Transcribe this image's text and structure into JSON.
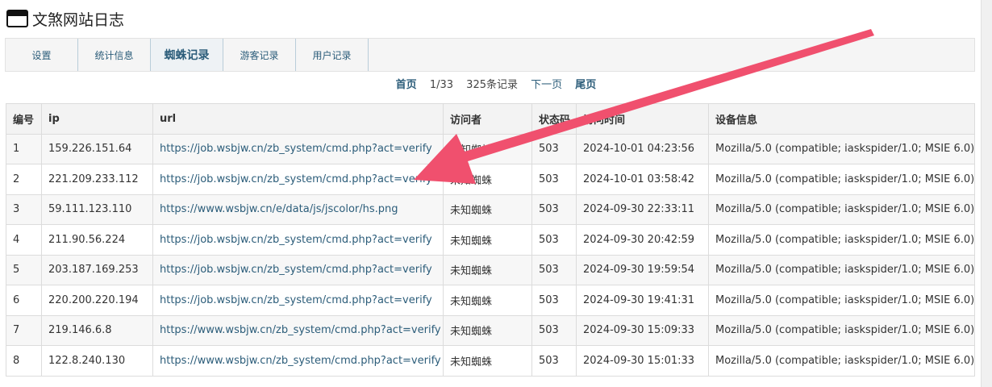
{
  "title": "文煞网站日志",
  "nav": {
    "tabs": [
      {
        "label": "设置",
        "active": false
      },
      {
        "label": "统计信息",
        "active": false
      },
      {
        "label": "蜘蛛记录",
        "active": true
      },
      {
        "label": "游客记录",
        "active": false
      },
      {
        "label": "用户记录",
        "active": false
      }
    ]
  },
  "pager": {
    "first": "首页",
    "page": "1/33",
    "count": "325条记录",
    "next": "下一页",
    "last": "尾页"
  },
  "table": {
    "headers": [
      "编号",
      "ip",
      "url",
      "访问者",
      "状态码",
      "访问时间",
      "设备信息"
    ],
    "rows": [
      [
        "1",
        "159.226.151.64",
        "https://job.wsbjw.cn/zb_system/cmd.php?act=verify",
        "未知蜘蛛",
        "503",
        "2024-10-01 04:23:56",
        "Mozilla/5.0 (compatible; iaskspider/1.0; MSIE 6.0)"
      ],
      [
        "2",
        "221.209.233.112",
        "https://job.wsbjw.cn/zb_system/cmd.php?act=verify",
        "未知蜘蛛",
        "503",
        "2024-10-01 03:58:42",
        "Mozilla/5.0 (compatible; iaskspider/1.0; MSIE 6.0)"
      ],
      [
        "3",
        "59.111.123.110",
        "https://www.wsbjw.cn/e/data/js/jscolor/hs.png",
        "未知蜘蛛",
        "503",
        "2024-09-30 22:33:11",
        "Mozilla/5.0 (compatible; iaskspider/1.0; MSIE 6.0)"
      ],
      [
        "4",
        "211.90.56.224",
        "https://job.wsbjw.cn/zb_system/cmd.php?act=verify",
        "未知蜘蛛",
        "503",
        "2024-09-30 20:42:59",
        "Mozilla/5.0 (compatible; iaskspider/1.0; MSIE 6.0)"
      ],
      [
        "5",
        "203.187.169.253",
        "https://job.wsbjw.cn/zb_system/cmd.php?act=verify",
        "未知蜘蛛",
        "503",
        "2024-09-30 19:59:54",
        "Mozilla/5.0 (compatible; iaskspider/1.0; MSIE 6.0)"
      ],
      [
        "6",
        "220.200.220.194",
        "https://job.wsbjw.cn/zb_system/cmd.php?act=verify",
        "未知蜘蛛",
        "503",
        "2024-09-30 19:41:31",
        "Mozilla/5.0 (compatible; iaskspider/1.0; MSIE 6.0)"
      ],
      [
        "7",
        "219.146.6.8",
        "https://www.wsbjw.cn/zb_system/cmd.php?act=verify",
        "未知蜘蛛",
        "503",
        "2024-09-30 15:09:33",
        "Mozilla/5.0 (compatible; iaskspider/1.0; MSIE 6.0)"
      ],
      [
        "8",
        "122.8.240.130",
        "https://www.wsbjw.cn/zb_system/cmd.php?act=verify",
        "未知蜘蛛",
        "503",
        "2024-09-30 15:01:33",
        "Mozilla/5.0 (compatible; iaskspider/1.0; MSIE 6.0)"
      ]
    ]
  },
  "colors": {
    "accent": "#2c5d7a",
    "annotation_arrow": "#f0506e"
  }
}
